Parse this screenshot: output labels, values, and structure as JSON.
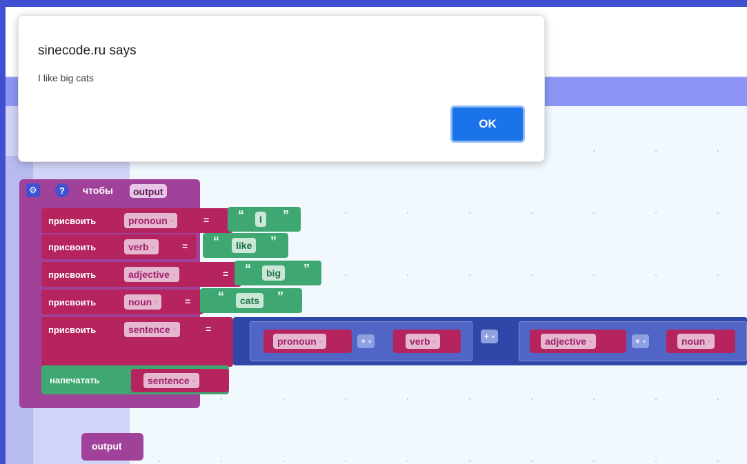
{
  "dialog": {
    "title": "sinecode.ru says",
    "message": "I like big cats",
    "ok_label": "OK"
  },
  "procedure": {
    "keyword": "чтобы",
    "name": "output",
    "gear_icon": "gear-icon",
    "help_icon": "?"
  },
  "statements": [
    {
      "label": "присвоить",
      "var": "pronoun",
      "eq": "=",
      "value": "I"
    },
    {
      "label": "присвоить",
      "var": "verb",
      "eq": "=",
      "value": "like"
    },
    {
      "label": "присвоить",
      "var": "adjective",
      "eq": "=",
      "value": "big"
    },
    {
      "label": "присвоить",
      "var": "noun",
      "eq": "=",
      "value": "cats"
    },
    {
      "label": "присвоить",
      "var": "sentence",
      "eq": "="
    }
  ],
  "quotes": {
    "open": "“",
    "close": "”"
  },
  "math": {
    "left": {
      "a": "pronoun",
      "op": "+",
      "b": "verb"
    },
    "mid_op": "+",
    "right": {
      "a": "adjective",
      "op": "+",
      "b": "noun"
    }
  },
  "print": {
    "label": "напечатать",
    "var": "sentence"
  },
  "call_block": {
    "name": "output"
  },
  "dropdown_arrow": "▾",
  "colors": {
    "procedure": "#a0429a",
    "variables": "#b5245f",
    "text": "#3fa872",
    "math": "#2f47a9",
    "dialog_button": "#1a73e8"
  }
}
